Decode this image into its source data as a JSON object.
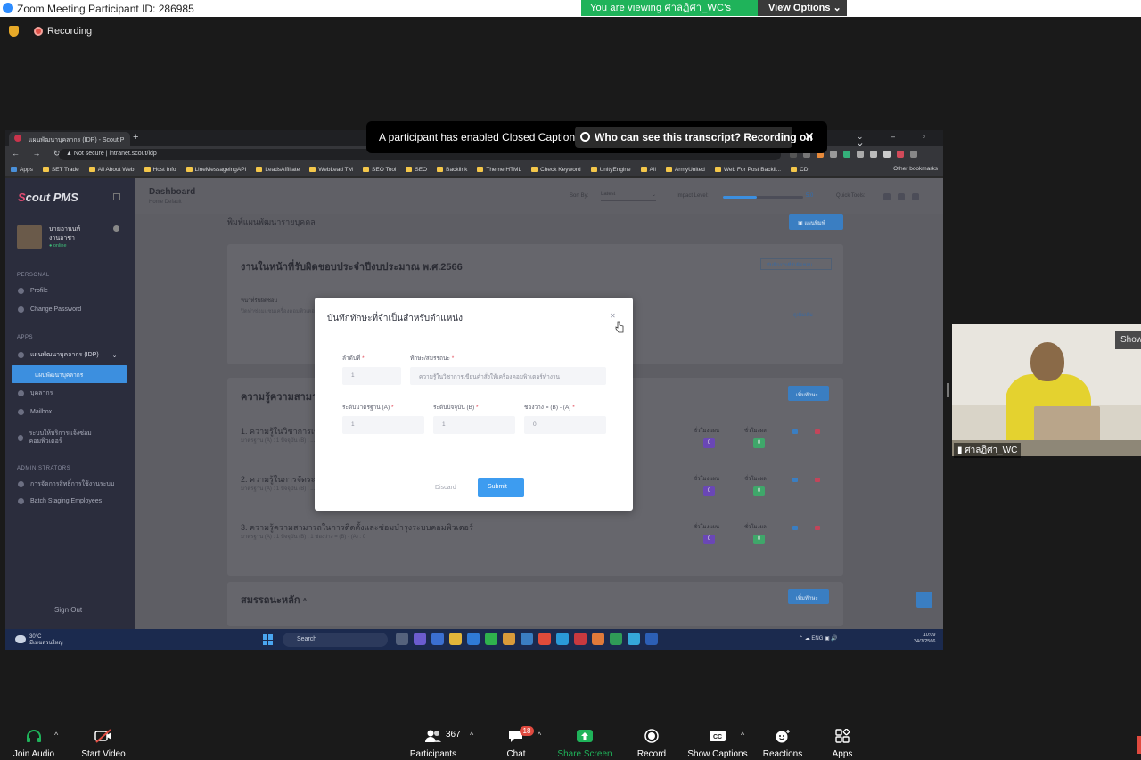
{
  "zoom": {
    "window_title": "Zoom Meeting Participant ID: 286985",
    "viewing_banner": "You are viewing ศาลฏิศา_WC's screen",
    "view_options": "View Options",
    "recording": "Recording",
    "caption_notice": "A participant has enabled Closed Captioning",
    "caption_link": "Who can see this transcript? Recording on",
    "caption_close": "✕",
    "participant_name": "ศาลฏิศา_WC",
    "show_button": "Show",
    "controls": {
      "join_audio": "Join Audio",
      "start_video": "Start Video",
      "participants": "Participants",
      "participant_count": "367",
      "chat": "Chat",
      "chat_badge": "18",
      "share_screen": "Share Screen",
      "record": "Record",
      "show_captions": "Show Captions",
      "reactions": "Reactions",
      "apps": "Apps"
    },
    "colors": {
      "share_green": "#1fb35a",
      "badge_red": "#e04a3f"
    }
  },
  "browser": {
    "tab_title": "แผนพัฒนาบุคลากร (IDP) - Scout P",
    "new_tab": "+",
    "window_controls": "⌄ – ▫ ✕",
    "address_security": "Not secure",
    "address_url": "intranet.scout/idp",
    "bookmarks": [
      "Apps",
      "SET Trade",
      "All About Web",
      "Host Info",
      "LineMessageingAPI",
      "LeadsAffiliate",
      "WebLead TM",
      "SEO Tool",
      "SEO",
      "Backlink",
      "Theme HTML",
      "Check Keyword",
      "UnityEngine",
      "All",
      "ArmyUnited",
      "Web For Post Backli...",
      "CDI"
    ],
    "other_bookmarks": "Other bookmarks"
  },
  "app": {
    "logo_prefix": "S",
    "logo_text": "cout PMS",
    "user_name_line1": "นายอานนท์",
    "user_name_line2": "งานอาชา",
    "user_status": "● online",
    "section_personal": "PERSONAL",
    "menu_profile": "Profile",
    "menu_change_password": "Change Password",
    "section_apps": "APPS",
    "menu_idp": "แผนพัฒนาบุคลากร (IDP)",
    "menu_idp_active": "แผนพัฒนาบุคลากร",
    "menu_people": "บุคลากร",
    "menu_mailbox": "Mailbox",
    "menu_system": "ระบบให้บริการแจ้งซ่อม คอมพิวเตอร์",
    "section_admin": "ADMINISTRATORS",
    "menu_admin1": "การจัดการสิทธิ์การใช้งานระบบ",
    "menu_admin2": "Batch Staging Employees",
    "sign_out": "Sign Out",
    "header_title": "Dashboard",
    "breadcrumb": "Home   Default",
    "sort_by": "Sort By:",
    "sort_value": "Latest",
    "impact_level": "Impact Level:",
    "impact_value": "5.0",
    "quick_tools": "Quick Tools:",
    "page_section_title": "พิมพ์แผนพัฒนารายบุคคล",
    "print_button": "แผนพิมพ์",
    "card1_title": "งานในหน้าที่รับผิดชอบประจำปีงบประมาณ พ.ศ.2566",
    "card1_link": "บันทึกงานที่รับผิดชอบ",
    "card1_sub": "หน้าที่รับผิดชอบ",
    "card1_body": "ปิดทำซ่อมแซมเครื่องคอมพิวเตอร์และอุปกรณ์ต่อพ่วงให้ใช้งานได้ตามปกติ ... ดูแลระบบเครือข่าย ... ให้คำปรึกษาและแก้ไขปัญหาการใช้งาน",
    "card1_more": "ดูเพิ่มเติม",
    "card2_title": "ความรู้ความสามารถ",
    "add_button": "เพิ่มทักษะ",
    "col_plan": "ชั่วโมงแผน",
    "col_result": "ชั่วโมงผล",
    "rows": [
      {
        "title": "1. ความรู้ในวิชาการเขียน...",
        "sub": "มาตรฐาน (A) : 1   ปัจจุบัน (B) : ...",
        "plan": "0",
        "result": "0"
      },
      {
        "title": "2. ความรู้ในการจัดระบบ...",
        "sub": "มาตรฐาน (A) : 1   ปัจจุบัน (B) : ...",
        "plan": "0",
        "result": "0"
      },
      {
        "title": "3. ความรู้ความสามารถในการติดตั้งและซ่อมบำรุงระบบคอมพิวเตอร์",
        "sub": "มาตรฐาน (A) : 1   ปัจจุบัน (B) : 1   ช่องว่าง = (B) - (A) : 0",
        "plan": "0",
        "result": "0"
      }
    ],
    "card3_title": "สมรรถนะหลัก",
    "card3_caret": "^"
  },
  "modal": {
    "title": "บันทึกทักษะที่จำเป็นสำหรับตำแหน่ง",
    "close": "✕",
    "label_order": "ลำดับที่",
    "value_order": "1",
    "label_skill": "ทักษะ/สมรรถนะ",
    "value_skill": "ความรู้ในวิชาการเขียนคำสั่งให้เครื่องคอมพิวเตอร์ทำงาน",
    "label_standard": "ระดับมาตรฐาน (A)",
    "value_standard": "1",
    "label_current": "ระดับปัจจุบัน (B)",
    "value_current": "1",
    "label_gap": "ช่องว่าง = (B) - (A)",
    "value_gap": "0",
    "required_mark": "*",
    "discard": "Discard",
    "submit": "Submit"
  },
  "taskbar": {
    "temp": "30°C",
    "weather_desc": "มีเมฆส่วนใหญ่",
    "search": "Search",
    "lang": "ENG",
    "time": "10:09",
    "date": "24/7/2566"
  }
}
